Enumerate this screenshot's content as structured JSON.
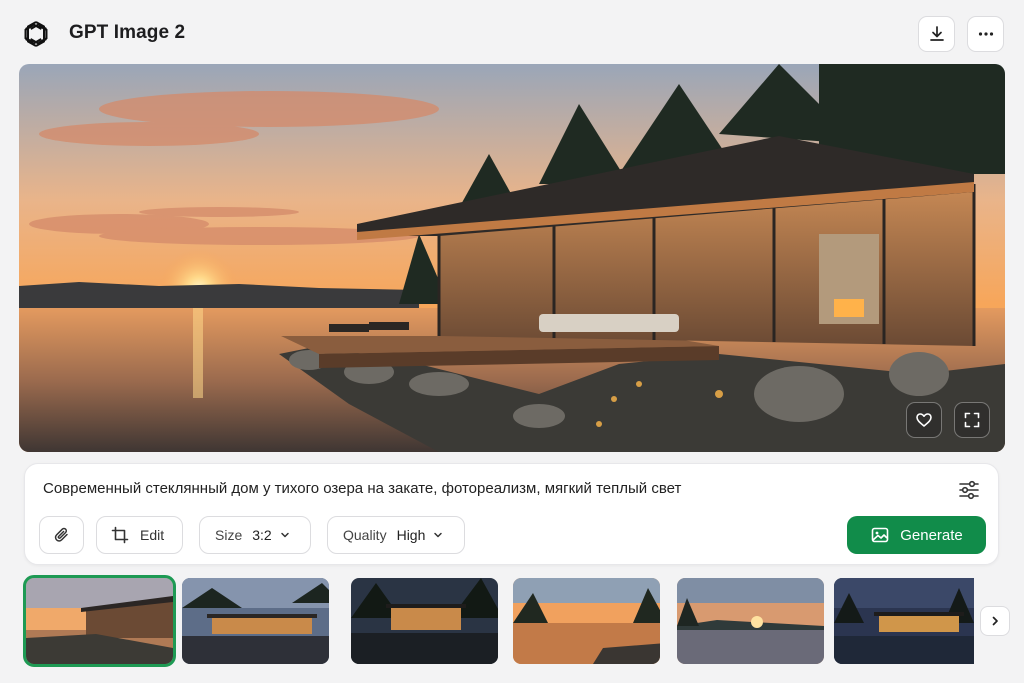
{
  "header": {
    "title": "GPT Image 2",
    "logo_icon": "openai-logo-icon",
    "download_icon": "download-icon",
    "more_icon": "more-horizontal-icon"
  },
  "image_actions": {
    "favorite_icon": "heart-icon",
    "fullscreen_icon": "expand-icon"
  },
  "prompt": {
    "text": "Современный стеклянный дом у тихого озера на закате, фотореализм, мягкий теплый свет",
    "settings_icon": "sliders-icon"
  },
  "controls": {
    "attach_icon": "paperclip-icon",
    "edit_label": "Edit",
    "edit_icon": "crop-icon",
    "size_label": "Size",
    "size_value": "3:2",
    "quality_label": "Quality",
    "quality_value": "High",
    "generate_label": "Generate",
    "generate_icon": "image-icon",
    "accent": "#118c4a"
  },
  "thumbnails": {
    "selected_index": 0,
    "next_icon": "chevron-right-icon"
  }
}
